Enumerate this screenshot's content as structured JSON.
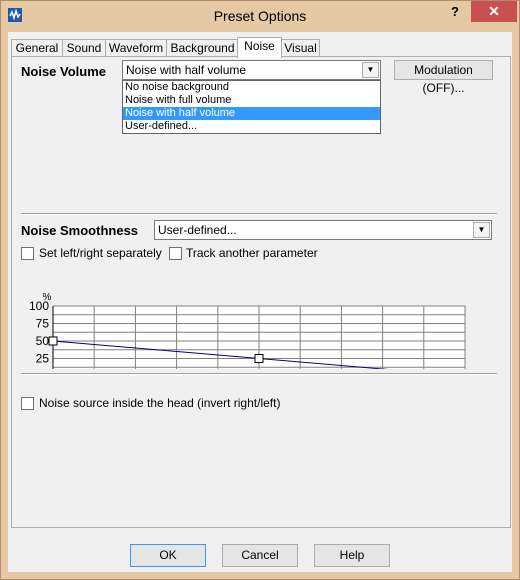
{
  "window": {
    "title": "Preset Options",
    "help_glyph": "?",
    "close_glyph": "✕"
  },
  "tabs": [
    {
      "label": "General"
    },
    {
      "label": "Sound"
    },
    {
      "label": "Waveform"
    },
    {
      "label": "Background"
    },
    {
      "label": "Noise"
    },
    {
      "label": "Visual"
    }
  ],
  "active_tab": "Noise",
  "noise_volume": {
    "label": "Noise Volume",
    "selected": "Noise with half volume",
    "options": [
      "No noise background",
      "Noise with full volume",
      "Noise with half volume",
      "User-defined..."
    ]
  },
  "modulation_button": "Modulation (OFF)...",
  "noise_smoothness": {
    "label": "Noise Smoothness",
    "selected": "User-defined..."
  },
  "checkboxes": {
    "left_right": {
      "label": "Set left/right separately",
      "checked": false
    },
    "track_param": {
      "label": "Track another parameter",
      "checked": false
    },
    "invert": {
      "label": "Noise source inside the head (invert right/left)",
      "checked": false
    }
  },
  "chart_data": {
    "type": "line",
    "ylabel": "%",
    "ylim": [
      0,
      100
    ],
    "xlim": [
      0,
      15
    ],
    "yticks": [
      "100",
      "75",
      "50",
      "25",
      "0"
    ],
    "xticks": [
      "0",
      "1.5",
      "3",
      "4.5",
      "6",
      "7.5",
      "9",
      "10.5",
      "12",
      "13.5",
      "15"
    ],
    "grid": true,
    "points": [
      {
        "x": 0,
        "y": 50
      },
      {
        "x": 7.5,
        "y": 25
      },
      {
        "x": 15,
        "y": 0
      }
    ],
    "line_color": "#000080"
  },
  "buttons": {
    "ok": "OK",
    "cancel": "Cancel",
    "help": "Help"
  }
}
